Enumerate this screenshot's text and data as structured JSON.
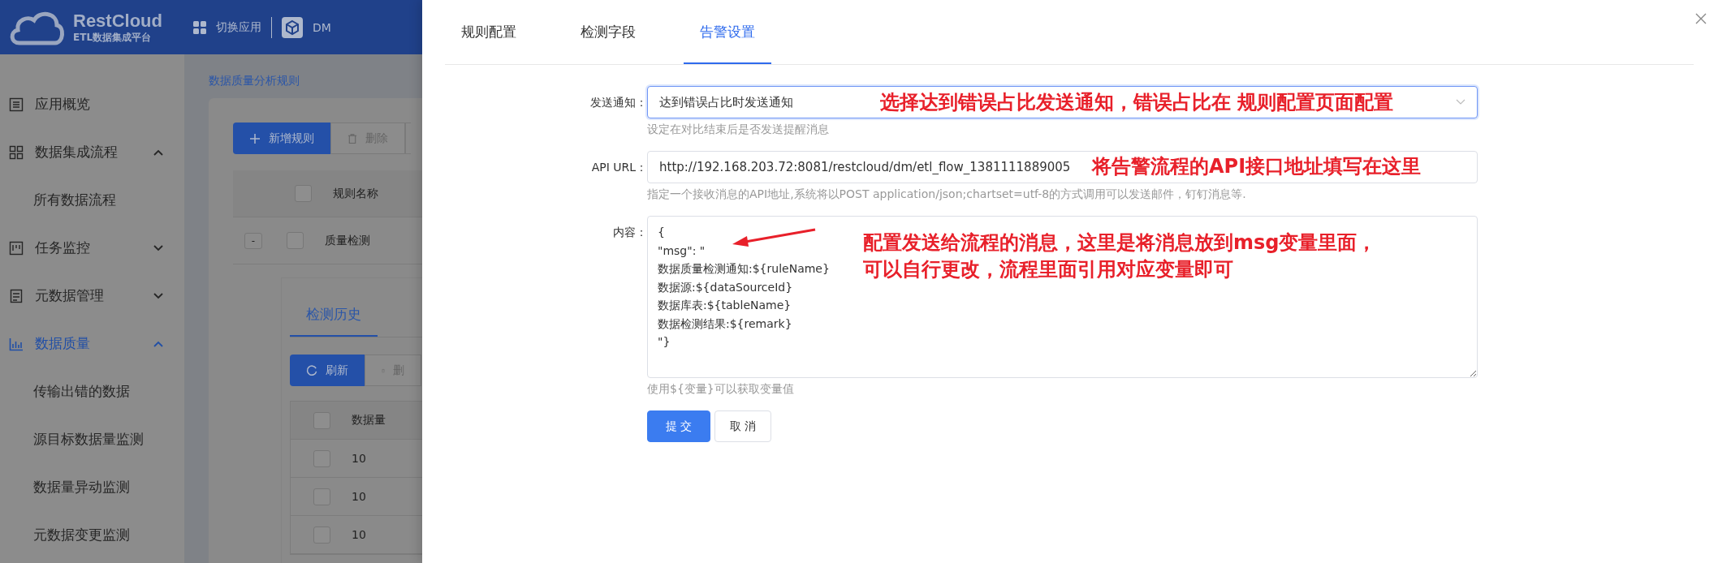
{
  "header": {
    "logo_title": "RestCloud",
    "logo_subtitle": "ETL数据集成平台",
    "switch_app": "切换应用",
    "app_name": "DM"
  },
  "sidebar": {
    "items": [
      {
        "label": "应用概览",
        "kind": "link",
        "selected": false
      },
      {
        "label": "数据集成流程",
        "kind": "group",
        "selected": false,
        "expanded": true,
        "children": [
          {
            "label": "所有数据流程",
            "selected": false
          }
        ]
      },
      {
        "label": "任务监控",
        "kind": "group",
        "selected": false,
        "expanded": false
      },
      {
        "label": "元数据管理",
        "kind": "group",
        "selected": false,
        "expanded": false
      },
      {
        "label": "数据质量",
        "kind": "group",
        "selected": true,
        "expanded": true,
        "children": [
          {
            "label": "传输出错的数据",
            "selected": false
          },
          {
            "label": "源目标数据量监测",
            "selected": false
          },
          {
            "label": "数据量异动监测",
            "selected": false
          },
          {
            "label": "元数据变更监测",
            "selected": false
          }
        ]
      }
    ]
  },
  "breadcrumb": "数据质量分析规则",
  "rules_toolbar": [
    {
      "label": "新增规则",
      "kind": "primary"
    },
    {
      "label": "删除",
      "kind": "plain"
    }
  ],
  "rules_table": {
    "all_checked": false,
    "columns": [
      "规则名称"
    ],
    "rows": [
      {
        "toggle": "-",
        "checked": false,
        "cells": [
          "质量检测"
        ]
      }
    ]
  },
  "history": {
    "tabs": [
      {
        "label": "检测历史",
        "selected": true
      }
    ],
    "toolbar": [
      {
        "label": "刷新",
        "kind": "primary"
      },
      {
        "label": "删",
        "kind": "plain"
      }
    ],
    "all_checked": false,
    "columns": [
      "数据量"
    ],
    "rows": [
      {
        "checked": false,
        "cells": [
          "10"
        ]
      },
      {
        "checked": false,
        "cells": [
          "10"
        ]
      },
      {
        "checked": false,
        "cells": [
          "10"
        ]
      }
    ]
  },
  "drawer": {
    "tabs": [
      {
        "label": "规则配置",
        "selected": false
      },
      {
        "label": "检测字段",
        "selected": false
      },
      {
        "label": "告警设置",
        "selected": true
      }
    ],
    "fields": [
      {
        "label": "发送通知：",
        "kind": "select",
        "value": "达到错误占比时发送通知",
        "hint": "设定在对比结束后是否发送提醒消息"
      },
      {
        "label": "API URL：",
        "kind": "input",
        "value": "http://192.168.203.72:8081/restcloud/dm/etl_flow_1381111889005",
        "hint": "指定一个接收消息的API地址,系统将以POST application/json;chartset=utf-8的方式调用可以发送邮件，钉钉消息等."
      },
      {
        "label": "内容：",
        "kind": "textarea",
        "value": "{\n\"msg\": \"\n数据质量检测通知:${ruleName}\n数据源:${dataSourceId}\n数据库表:${tableName}\n数据检测结果:${remark}\n\"}",
        "hint": "使用${变量}可以获取变量值"
      }
    ],
    "buttons": [
      {
        "label": "提 交",
        "kind": "primary"
      },
      {
        "label": "取 消",
        "kind": "plain"
      }
    ]
  },
  "annotations": [
    {
      "kind": "in_select",
      "lines": [
        "选择达到错误占比发送通知，错误占比在 规则配置页面配置"
      ]
    },
    {
      "kind": "free",
      "lines": [
        "将告警流程的API接口地址填写在这里"
      ]
    },
    {
      "kind": "free",
      "lines": [
        "配置发送给流程的消息，这里是将消息放到msg变量里面，",
        "可以自行更改，流程里面引用对应变量即可"
      ],
      "arrow": true
    }
  ]
}
